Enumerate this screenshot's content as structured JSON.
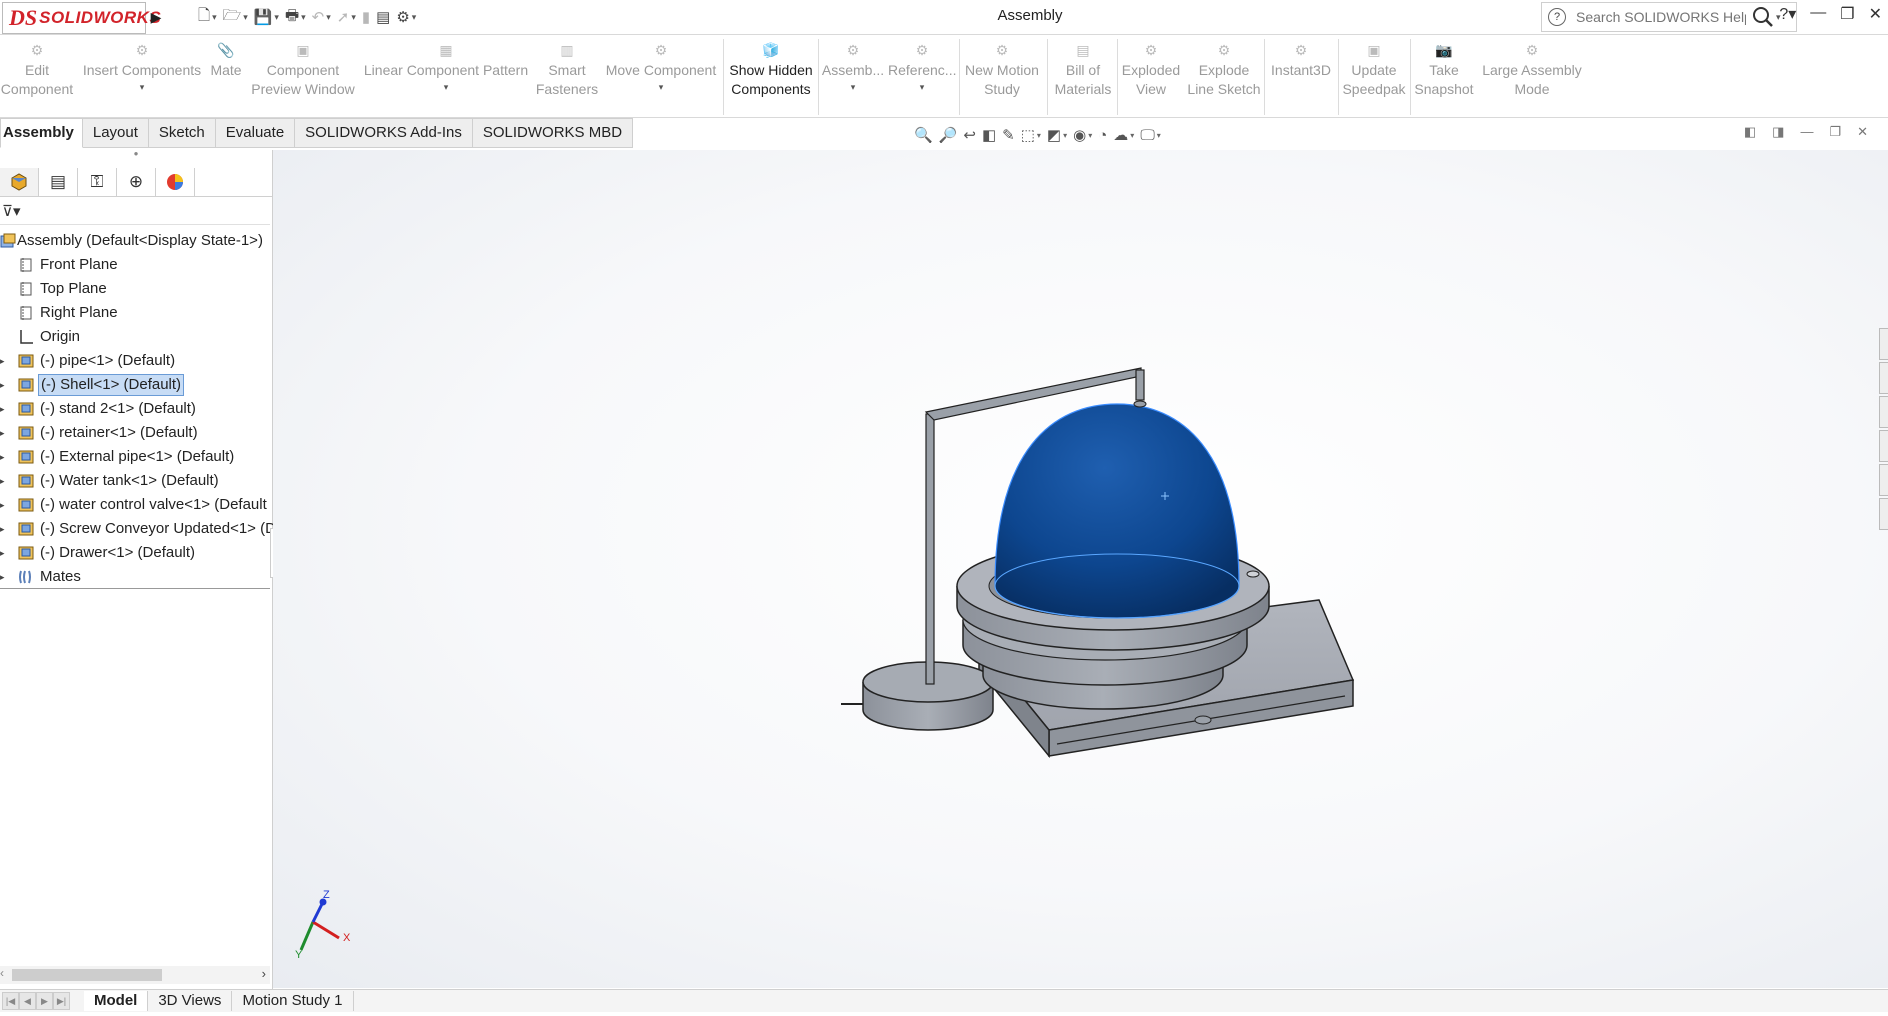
{
  "app": {
    "logo_ds": "DS",
    "logo_text": "SOLIDWORKS",
    "title": "Assembly",
    "search_placeholder": "Search SOLIDWORKS Help"
  },
  "toolbar": {
    "items": [
      {
        "label1": "Edit",
        "label2": "Component",
        "active": false
      },
      {
        "label1": "Insert Components",
        "label2": "",
        "active": false
      },
      {
        "label1": "Mate",
        "label2": "",
        "active": false
      },
      {
        "label1": "Component",
        "label2": "Preview Window",
        "active": false
      },
      {
        "label1": "Linear Component Pattern",
        "label2": "",
        "active": false
      },
      {
        "label1": "Smart",
        "label2": "Fasteners",
        "active": false
      },
      {
        "label1": "Move Component",
        "label2": "",
        "active": false
      },
      {
        "label1": "Show Hidden",
        "label2": "Components",
        "active": true
      },
      {
        "label1": "Assemb...",
        "label2": "",
        "active": false
      },
      {
        "label1": "Referenc...",
        "label2": "",
        "active": false
      },
      {
        "label1": "New Motion",
        "label2": "Study",
        "active": false
      },
      {
        "label1": "Bill of",
        "label2": "Materials",
        "active": false
      },
      {
        "label1": "Exploded",
        "label2": "View",
        "active": false
      },
      {
        "label1": "Explode",
        "label2": "Line Sketch",
        "active": false
      },
      {
        "label1": "Instant3D",
        "label2": "",
        "active": false
      },
      {
        "label1": "Update",
        "label2": "Speedpak",
        "active": false
      },
      {
        "label1": "Take",
        "label2": "Snapshot",
        "active": false
      },
      {
        "label1": "Large Assembly",
        "label2": "Mode",
        "active": false
      }
    ]
  },
  "tabs": [
    "Assembly",
    "Layout",
    "Sketch",
    "Evaluate",
    "SOLIDWORKS Add-Ins",
    "SOLIDWORKS MBD"
  ],
  "tree": {
    "root": "Assembly  (Default<Display State-1>)",
    "planes": [
      "Front Plane",
      "Top Plane",
      "Right Plane"
    ],
    "origin": "Origin",
    "components": [
      "(-) pipe<1> (Default)",
      "(-) Shell<1> (Default)",
      "(-) stand 2<1> (Default)",
      "(-) retainer<1> (Default)",
      "(-) External pipe<1> (Default)",
      "(-) Water tank<1> (Default)",
      "(-) water control valve<1> (Default",
      "(-) Screw Conveyor Updated<1> (D",
      "(-) Drawer<1> (Default)"
    ],
    "selected_index": 1,
    "mates": "Mates"
  },
  "bottom_tabs": [
    "Model",
    "3D Views",
    "Motion Study 1"
  ],
  "triad": {
    "x": "X",
    "y": "Y",
    "z": "Z"
  },
  "colors": {
    "dome": "#1f5fb0",
    "metal": "#9aa0aa",
    "accent": "#d2232a",
    "selection": "#c7dcf5"
  }
}
